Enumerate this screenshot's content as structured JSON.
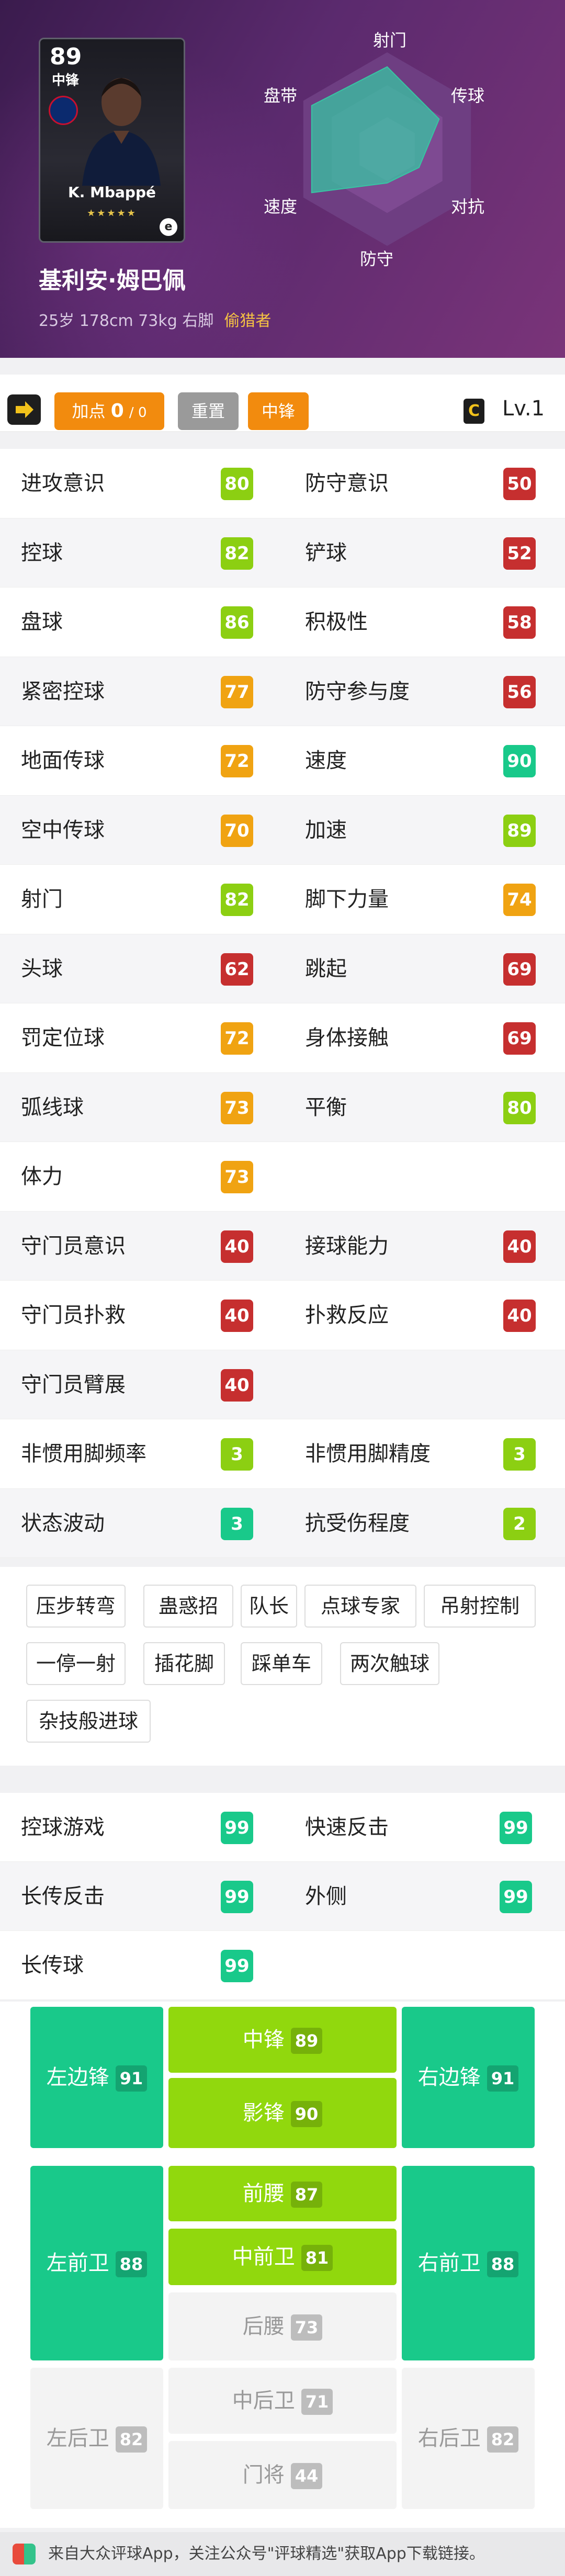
{
  "card": {
    "rating": "89",
    "position": "中锋",
    "name": "K. Mbappé",
    "stars": "★★★★★",
    "badge": "e"
  },
  "player": {
    "name": "基利安·姆巴佩",
    "info": "25岁 178cm 73kg 右脚",
    "role": "偷猎者"
  },
  "radar": {
    "labels": [
      "射门",
      "传球",
      "对抗",
      "防守",
      "速度",
      "盘带"
    ],
    "values": [
      0.85,
      0.62,
      0.38,
      0.35,
      0.9,
      0.9
    ],
    "fill": "#38c5a3"
  },
  "toolbar": {
    "points_label": "加点",
    "points_value": "0",
    "points_total": "/ 0",
    "reset": "重置",
    "position": "中锋",
    "level_icon": "C",
    "level": "Lv.1"
  },
  "stats": [
    [
      {
        "label": "进攻意识",
        "value": "80",
        "color": "#8ccf12"
      },
      {
        "label": "防守意识",
        "value": "50",
        "color": "#c62f2f"
      }
    ],
    [
      {
        "label": "控球",
        "value": "82",
        "color": "#8ccf12"
      },
      {
        "label": "铲球",
        "value": "52",
        "color": "#c62f2f"
      }
    ],
    [
      {
        "label": "盘球",
        "value": "86",
        "color": "#8ccf12"
      },
      {
        "label": "积极性",
        "value": "58",
        "color": "#c62f2f"
      }
    ],
    [
      {
        "label": "紧密控球",
        "value": "77",
        "color": "#f0a312"
      },
      {
        "label": "防守参与度",
        "value": "56",
        "color": "#c62f2f"
      }
    ],
    [
      {
        "label": "地面传球",
        "value": "72",
        "color": "#f0a312"
      },
      {
        "label": "速度",
        "value": "90",
        "color": "#19c98a"
      }
    ],
    [
      {
        "label": "空中传球",
        "value": "70",
        "color": "#f0a312"
      },
      {
        "label": "加速",
        "value": "89",
        "color": "#8ccf12"
      }
    ],
    [
      {
        "label": "射门",
        "value": "82",
        "color": "#8ccf12"
      },
      {
        "label": "脚下力量",
        "value": "74",
        "color": "#f0a312"
      }
    ],
    [
      {
        "label": "头球",
        "value": "62",
        "color": "#c62f2f"
      },
      {
        "label": "跳起",
        "value": "69",
        "color": "#c62f2f"
      }
    ],
    [
      {
        "label": "罚定位球",
        "value": "72",
        "color": "#f0a312"
      },
      {
        "label": "身体接触",
        "value": "69",
        "color": "#c62f2f"
      }
    ],
    [
      {
        "label": "弧线球",
        "value": "73",
        "color": "#f0a312"
      },
      {
        "label": "平衡",
        "value": "80",
        "color": "#8ccf12"
      }
    ],
    [
      {
        "label": "体力",
        "value": "73",
        "color": "#f0a312"
      },
      null
    ],
    [
      {
        "label": "守门员意识",
        "value": "40",
        "color": "#c62f2f"
      },
      {
        "label": "接球能力",
        "value": "40",
        "color": "#c62f2f"
      }
    ],
    [
      {
        "label": "守门员扑救",
        "value": "40",
        "color": "#c62f2f"
      },
      {
        "label": "扑救反应",
        "value": "40",
        "color": "#c62f2f"
      }
    ],
    [
      {
        "label": "守门员臂展",
        "value": "40",
        "color": "#c62f2f"
      },
      null
    ],
    [
      {
        "label": "非惯用脚频率",
        "value": "3",
        "color": "#8ccf12"
      },
      {
        "label": "非惯用脚精度",
        "value": "3",
        "color": "#8ccf12"
      }
    ],
    [
      {
        "label": "状态波动",
        "value": "3",
        "color": "#19c98a"
      },
      {
        "label": "抗受伤程度",
        "value": "2",
        "color": "#8ccf12"
      }
    ]
  ],
  "skills": [
    "压步转弯",
    "蛊惑招",
    "队长",
    "点球专家",
    "吊射控制",
    "一停一射",
    "插花脚",
    "踩单车",
    "两次触球",
    "杂技般进球"
  ],
  "playstyles": [
    [
      {
        "label": "控球游戏",
        "value": "99"
      },
      {
        "label": "快速反击",
        "value": "99"
      }
    ],
    [
      {
        "label": "长传反击",
        "value": "99"
      },
      {
        "label": "外侧",
        "value": "99"
      }
    ],
    [
      {
        "label": "长传球",
        "value": "99"
      },
      null
    ]
  ],
  "playstyle_color": "#19c98a",
  "positions": {
    "lwf": {
      "label": "左边锋",
      "value": "91"
    },
    "cf": {
      "label": "中锋",
      "value": "89"
    },
    "rwf": {
      "label": "右边锋",
      "value": "91"
    },
    "ss": {
      "label": "影锋",
      "value": "90"
    },
    "lmf": {
      "label": "左前卫",
      "value": "88"
    },
    "amf": {
      "label": "前腰",
      "value": "87"
    },
    "rmf": {
      "label": "右前卫",
      "value": "88"
    },
    "cmf": {
      "label": "中前卫",
      "value": "81"
    },
    "dmf": {
      "label": "后腰",
      "value": "73"
    },
    "lb": {
      "label": "左后卫",
      "value": "82"
    },
    "cb": {
      "label": "中后卫",
      "value": "71"
    },
    "rb": {
      "label": "右后卫",
      "value": "82"
    },
    "gk": {
      "label": "门将",
      "value": "44"
    }
  },
  "footer": "来自大众评球App，关注公众号\"评球精选\"获取App下载链接。"
}
